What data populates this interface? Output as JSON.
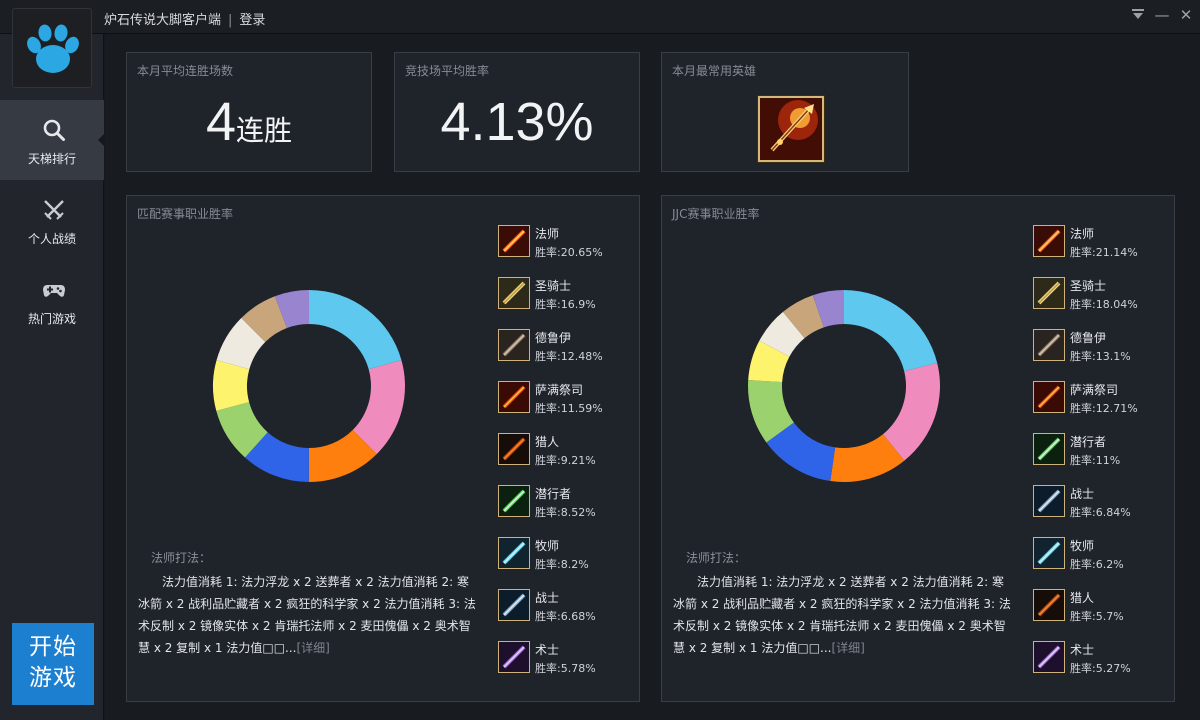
{
  "app": {
    "title": "炉石传说大脚客户端",
    "separator": "|",
    "login_label": "登录",
    "minimize_glyph": "—",
    "close_glyph": "✕"
  },
  "sidebar": {
    "logo_icon": "paw-icon",
    "items": [
      {
        "label": "天梯排行",
        "icon": "search-icon",
        "active": true
      },
      {
        "label": "个人战绩",
        "icon": "crossed-swords-icon",
        "active": false
      },
      {
        "label": "热门游戏",
        "icon": "gamepad-icon",
        "active": false
      }
    ],
    "start_label": "开始游戏"
  },
  "stats": {
    "streak": {
      "label": "本月平均连胜场数",
      "value": "4",
      "unit": "连胜"
    },
    "arena": {
      "label": "竞技场平均胜率",
      "value": "4.13%"
    },
    "hero": {
      "label": "本月最常用英雄",
      "icon": "mage-hero-icon"
    }
  },
  "colors": {
    "slices": [
      "#5ec8ef",
      "#f08bbd",
      "#ff7f0e",
      "#2f63e8",
      "#9bd26d",
      "#fef36c",
      "#eeeae0",
      "#c8a57b",
      "#9984cf"
    ],
    "start_button": "#1d7fd0",
    "accent_gold": "#cfb27a"
  },
  "panels": [
    {
      "title": "匹配赛事职业胜率",
      "classes": [
        {
          "name": "法师",
          "rate": "胜率:20.65%",
          "icon": "mage-icon"
        },
        {
          "name": "圣骑士",
          "rate": "胜率:16.9%",
          "icon": "paladin-icon"
        },
        {
          "name": "德鲁伊",
          "rate": "胜率:12.48%",
          "icon": "druid-icon"
        },
        {
          "name": "萨满祭司",
          "rate": "胜率:11.59%",
          "icon": "shaman-icon"
        },
        {
          "name": "猎人",
          "rate": "胜率:9.21%",
          "icon": "hunter-icon"
        },
        {
          "name": "潜行者",
          "rate": "胜率:8.52%",
          "icon": "rogue-icon"
        },
        {
          "name": "牧师",
          "rate": "胜率:8.2%",
          "icon": "priest-icon"
        },
        {
          "name": "战士",
          "rate": "胜率:6.68%",
          "icon": "warrior-icon"
        },
        {
          "name": "术士",
          "rate": "胜率:5.78%",
          "icon": "warlock-icon"
        }
      ],
      "deck_title": "法师打法：",
      "deck_text": "法力值消耗 1: 法力浮龙 x 2   送葬者 x 2   法力值消耗 2: 寒冰箭 x 2   战利品贮藏者 x 2   疯狂的科学家 x 2   法力值消耗 3: 法术反制 x 2   镜像实体 x 2   肯瑞托法师 x 2   麦田傀儡 x 2   奥术智慧 x 2   复制 x 1   法力值□□...",
      "more_label": "[详细]"
    },
    {
      "title": "JJC赛事职业胜率",
      "classes": [
        {
          "name": "法师",
          "rate": "胜率:21.14%",
          "icon": "mage-icon"
        },
        {
          "name": "圣骑士",
          "rate": "胜率:18.04%",
          "icon": "paladin-icon"
        },
        {
          "name": "德鲁伊",
          "rate": "胜率:13.1%",
          "icon": "druid-icon"
        },
        {
          "name": "萨满祭司",
          "rate": "胜率:12.71%",
          "icon": "shaman-icon"
        },
        {
          "name": "潜行者",
          "rate": "胜率:11%",
          "icon": "rogue-icon"
        },
        {
          "name": "战士",
          "rate": "胜率:6.84%",
          "icon": "warrior-icon"
        },
        {
          "name": "牧师",
          "rate": "胜率:6.2%",
          "icon": "priest-icon"
        },
        {
          "name": "猎人",
          "rate": "胜率:5.7%",
          "icon": "hunter-icon"
        },
        {
          "name": "术士",
          "rate": "胜率:5.27%",
          "icon": "warlock-icon"
        }
      ],
      "deck_title": "法师打法：",
      "deck_text": "法力值消耗 1: 法力浮龙 x 2   送葬者 x 2   法力值消耗 2: 寒冰箭 x 2   战利品贮藏者 x 2   疯狂的科学家 x 2   法力值消耗 3: 法术反制 x 2   镜像实体 x 2   肯瑞托法师 x 2   麦田傀儡 x 2   奥术智慧 x 2   复制 x 1   法力值□□...",
      "more_label": "[详细]"
    }
  ],
  "chart_data": [
    {
      "type": "pie",
      "title": "匹配赛事职业胜率",
      "categories": [
        "法师",
        "圣骑士",
        "德鲁伊",
        "萨满祭司",
        "猎人",
        "潜行者",
        "牧师",
        "战士",
        "术士"
      ],
      "values": [
        20.65,
        16.9,
        12.48,
        11.59,
        9.21,
        8.52,
        8.2,
        6.68,
        5.78
      ]
    },
    {
      "type": "pie",
      "title": "JJC赛事职业胜率",
      "categories": [
        "法师",
        "圣骑士",
        "德鲁伊",
        "萨满祭司",
        "潜行者",
        "战士",
        "牧师",
        "猎人",
        "术士"
      ],
      "values": [
        21.14,
        18.04,
        13.1,
        12.71,
        11,
        6.84,
        6.2,
        5.7,
        5.27
      ]
    }
  ]
}
